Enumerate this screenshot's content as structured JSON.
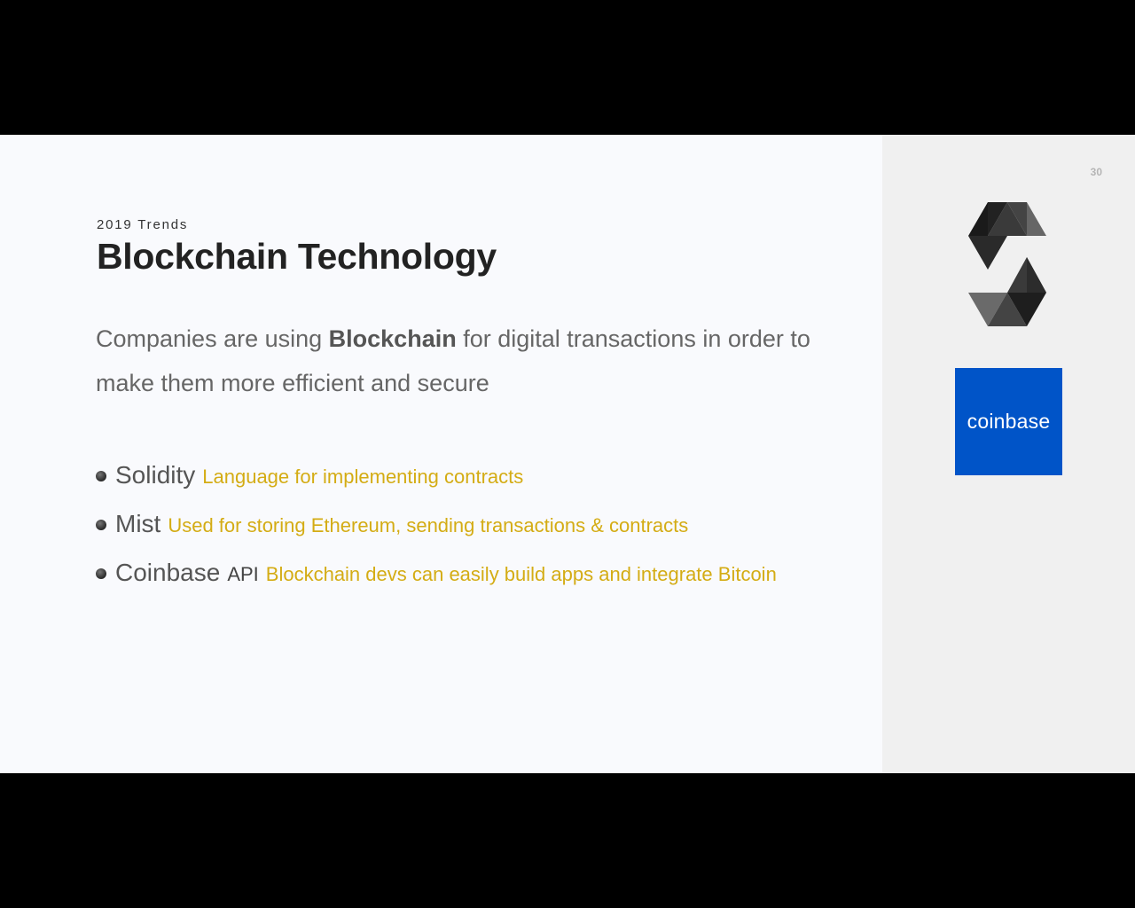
{
  "slide": {
    "page_number": "30",
    "subtitle": "2019 Trends",
    "title": "Blockchain Technology",
    "lead": {
      "before": "Companies are using ",
      "bold": "Blockchain",
      "after": " for digital transactions in order to make them more efficient and secure"
    },
    "bullets": [
      {
        "name": "Solidity",
        "suffix": "",
        "desc": "Language for implementing contracts"
      },
      {
        "name": "Mist",
        "suffix": "",
        "desc": "Used for storing Ethereum, sending transactions & contracts"
      },
      {
        "name": "Coinbase",
        "suffix": "API",
        "desc": "Blockchain devs can easily build apps and integrate Bitcoin"
      }
    ]
  },
  "sidebar": {
    "logos": [
      {
        "icon": "solidity-logo-icon"
      },
      {
        "icon": "coinbase-logo-icon",
        "text": "coinbase",
        "color": "#0054c8"
      }
    ]
  },
  "colors": {
    "accent_yellow": "#d4ac14",
    "panel_bg": "#f0f0f0",
    "slide_bg": "#f9fafd"
  }
}
